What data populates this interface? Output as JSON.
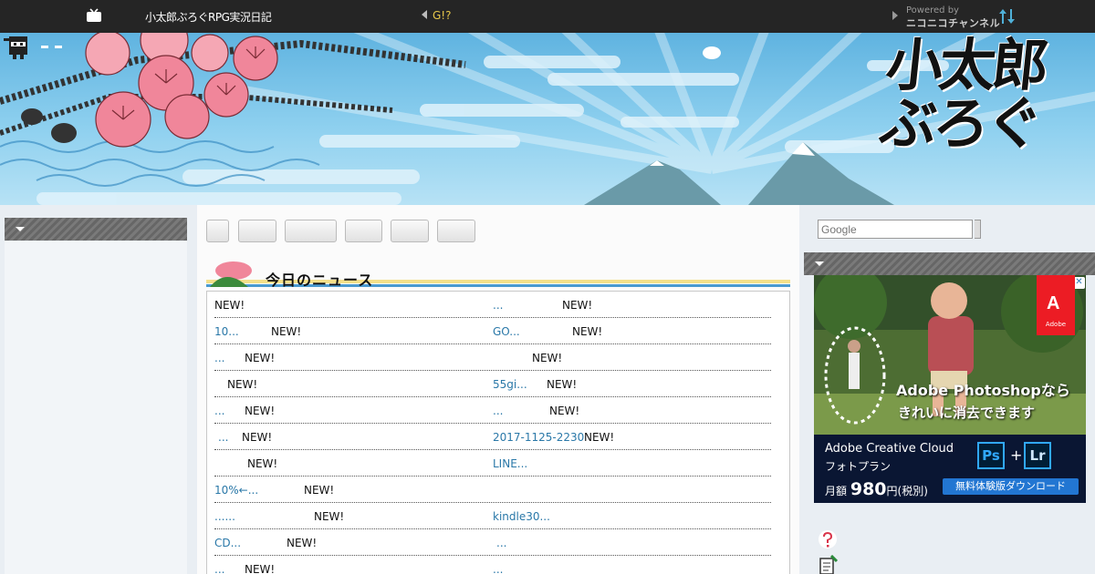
{
  "topbar": {
    "site_title": "小太郎ぶろぐRPG実況日記",
    "nav_link": "G!?",
    "powered_by": "Powered by",
    "powered_brand": "ニコニコチャンネル"
  },
  "banner": {
    "logo": "小太郎ぶろぐ"
  },
  "search": {
    "placeholder": "Google"
  },
  "news": {
    "title": "今日のニュース",
    "rows": [
      {
        "left_link": "",
        "left_new": "NEW!",
        "right_link": "...",
        "right_new": "NEW!"
      },
      {
        "left_link": "10...",
        "left_new": "NEW!",
        "right_link": "GO...",
        "right_new": "NEW!"
      },
      {
        "left_link": "...",
        "left_new": "NEW!",
        "right_link": "",
        "right_new": "NEW!"
      },
      {
        "left_link": "",
        "left_new": "NEW!",
        "right_link": "55gi...",
        "right_new": "NEW!"
      },
      {
        "left_link": "...",
        "left_new": "NEW!",
        "right_link": "...",
        "right_new": "NEW!"
      },
      {
        "left_link": "...",
        "left_new": "NEW!",
        "right_link": "2017-1125-2230",
        "right_new": "NEW!"
      },
      {
        "left_link": "",
        "left_new": "NEW!",
        "right_link": "LINE...",
        "right_new": ""
      },
      {
        "left_link": "10%←...",
        "left_new": "NEW!",
        "right_link": "",
        "right_new": ""
      },
      {
        "left_link": "......",
        "left_new": "NEW!",
        "right_link": "kindle30...",
        "right_new": ""
      },
      {
        "left_link": "CD...",
        "left_new": "NEW!",
        "right_link": "...",
        "right_new": ""
      },
      {
        "left_link": "...",
        "left_new": "NEW!",
        "right_link": "...",
        "right_new": ""
      }
    ]
  },
  "ad": {
    "headline1": "Adobe Photoshopなら",
    "headline2": "きれいに消去できます",
    "product": "Adobe Creative Cloud",
    "plan": "フォトプラン",
    "price_prefix": "月額",
    "price": "980",
    "price_suffix": "円(税別)",
    "ps": "Ps",
    "plus": "+",
    "lr": "Lr",
    "cta": "無料体験版ダウンロード",
    "adobe": "Adobe",
    "adobe_mark": "A",
    "info": "i",
    "close": "✕"
  },
  "colors": {
    "topbar": "#252525",
    "link": "#2a78a8",
    "nav_link": "#e8c84a",
    "side_header": "#6e6e6e",
    "adobe_red": "#ec1c24",
    "cta_blue": "#2276d2"
  },
  "icons": [
    "tv-icon",
    "sort-arrows-icon",
    "ninja-icon",
    "help-question-icon",
    "memo-icon",
    "chevron-down-icon"
  ]
}
